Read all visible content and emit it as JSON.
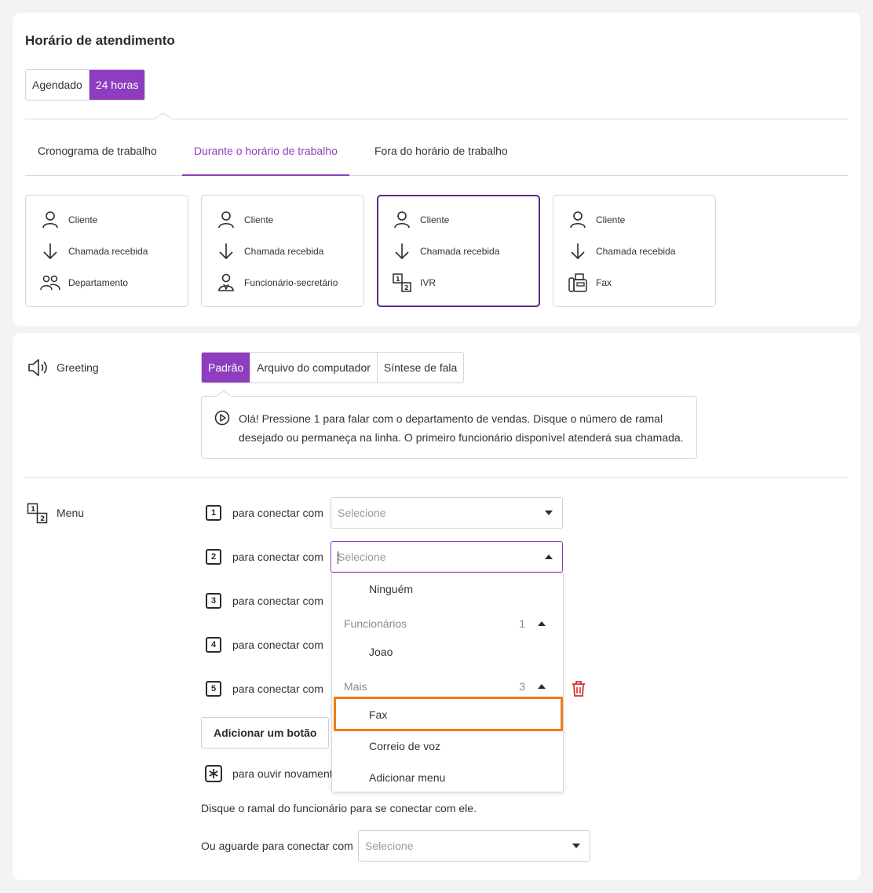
{
  "schedule": {
    "title": "Horário de atendimento",
    "modes": [
      "Agendado",
      "24 horas"
    ],
    "active_mode": "24 horas"
  },
  "tabs": [
    "Cronograma de trabalho",
    "Durante o horário de trabalho",
    "Fora do horário de trabalho"
  ],
  "active_tab": "Durante o horário de trabalho",
  "flows": [
    {
      "client": "Cliente",
      "incoming": "Chamada recebida",
      "target": "Departamento",
      "target_icon": "group-icon"
    },
    {
      "client": "Cliente",
      "incoming": "Chamada recebida",
      "target": "Funcionário-secretário",
      "target_icon": "secretary-icon"
    },
    {
      "client": "Cliente",
      "incoming": "Chamada recebida",
      "target": "IVR",
      "target_icon": "ivr-icon",
      "selected": true
    },
    {
      "client": "Cliente",
      "incoming": "Chamada recebida",
      "target": "Fax",
      "target_icon": "fax-icon"
    }
  ],
  "greeting": {
    "label": "Greeting",
    "sources": [
      "Padrão",
      "Arquivo do computador",
      "Síntese de fala"
    ],
    "active_source": "Padrão",
    "message": "Olá! Pressione 1 para falar com o departamento de vendas. Disque o número de ramal desejado ou permaneça na linha. O primeiro funcionário disponível atenderá sua chamada."
  },
  "menu": {
    "label": "Menu",
    "connect_text": "para conectar com",
    "placeholder": "Selecione",
    "keys": [
      "1",
      "2",
      "3",
      "4",
      "5"
    ],
    "add_button": "Adicionar um botão",
    "repeat_text": "para ouvir novament",
    "extension_hint": "Disque o ramal do funcionário para se conectar com ele.",
    "wait_label": "Ou aguarde para conectar com"
  },
  "dropdown": {
    "none_option": "Ninguém",
    "groups": [
      {
        "name": "Funcionários",
        "count": "1",
        "items": [
          "Joao"
        ]
      },
      {
        "name": "Mais",
        "count": "3",
        "items": [
          "Fax",
          "Correio de voz",
          "Adicionar menu"
        ]
      }
    ],
    "highlighted": "Fax"
  },
  "colors": {
    "accent": "#8e3dbf",
    "selected_border": "#5b2a83",
    "highlight": "#f07d1a",
    "danger": "#d0312d"
  }
}
